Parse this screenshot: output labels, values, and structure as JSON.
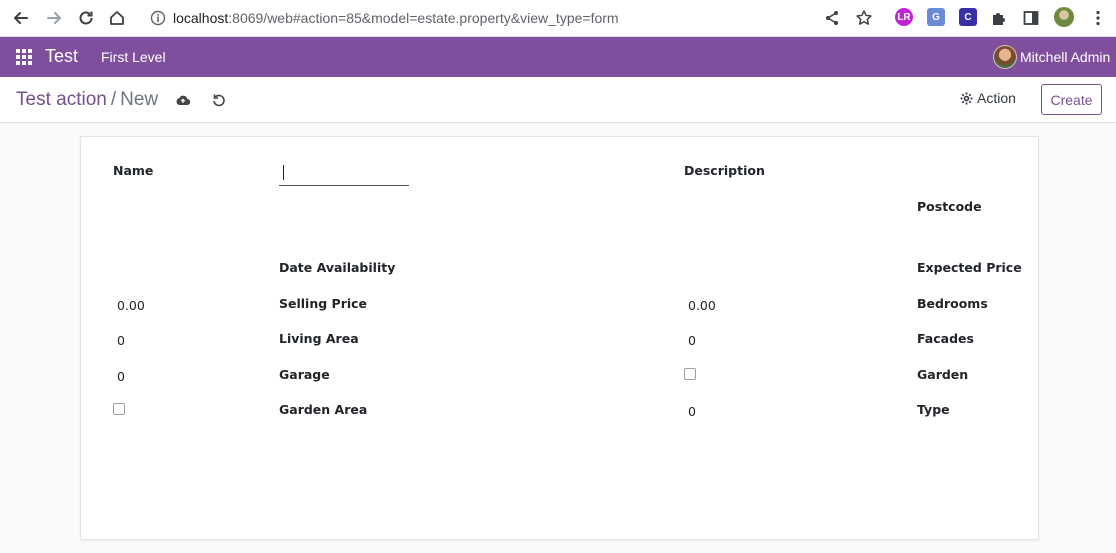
{
  "browser": {
    "url_host": "localhost",
    "url_rest": ":8069/web#action=85&model=estate.property&view_type=form"
  },
  "navbar": {
    "brand": "Test",
    "menu_item": "First Level",
    "user_name": "Mitchell Admin"
  },
  "control_panel": {
    "breadcrumb_parent": "Test action",
    "breadcrumb_separator": "/",
    "breadcrumb_current": "New",
    "action_label": "Action",
    "create_label": "Create"
  },
  "form": {
    "labels": {
      "name": "Name",
      "description": "Description",
      "postcode": "Postcode",
      "date_availability": "Date Availability",
      "expected_price": "Expected Price",
      "selling_price": "Selling Price",
      "bedrooms": "Bedrooms",
      "living_area": "Living Area",
      "facades": "Facades",
      "garage": "Garage",
      "garden": "Garden",
      "garden_area": "Garden Area",
      "type": "Type"
    },
    "values": {
      "name": "",
      "expected_price": "0.00",
      "selling_price": "0.00",
      "bedrooms": "0",
      "living_area": "0",
      "facades": "0",
      "garden_area": "0",
      "garage": false,
      "garden": false
    }
  }
}
